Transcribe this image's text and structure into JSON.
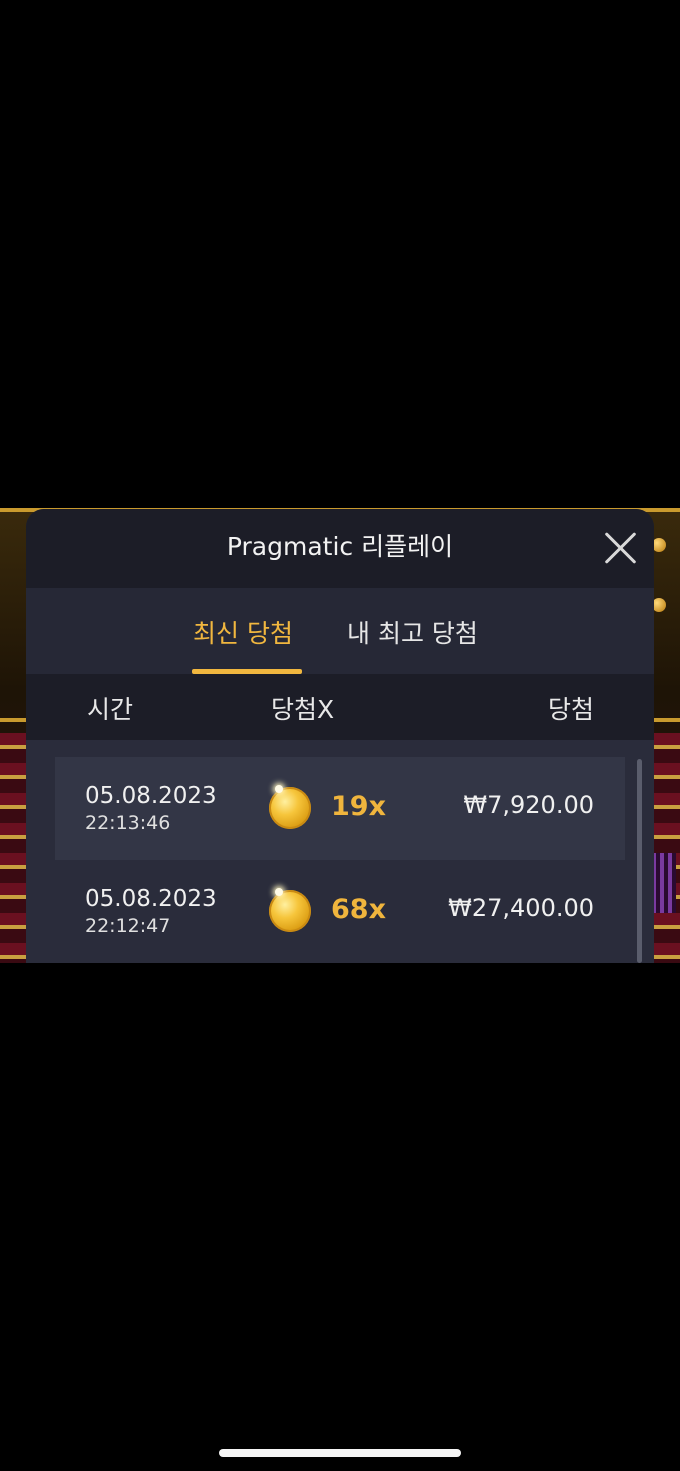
{
  "modal": {
    "title": "Pragmatic 리플레이",
    "close_icon": "close-icon"
  },
  "tabs": [
    {
      "label": "최신 당첨",
      "active": true
    },
    {
      "label": "내 최고 당첨",
      "active": false
    }
  ],
  "columns": {
    "time": "시간",
    "multiplier": "당첨X",
    "win": "당첨"
  },
  "rows": [
    {
      "date": "05.08.2023",
      "time": "22:13:46",
      "icon": "gold-coin-icon",
      "multiplier": "19x",
      "amount": "₩7,920.00"
    },
    {
      "date": "05.08.2023",
      "time": "22:12:47",
      "icon": "gold-coin-icon",
      "multiplier": "68x",
      "amount": "₩27,400.00"
    }
  ],
  "colors": {
    "accent": "#f1b73f",
    "modal_bg": "#2a2c3b",
    "header_bg": "#1c1d27"
  }
}
